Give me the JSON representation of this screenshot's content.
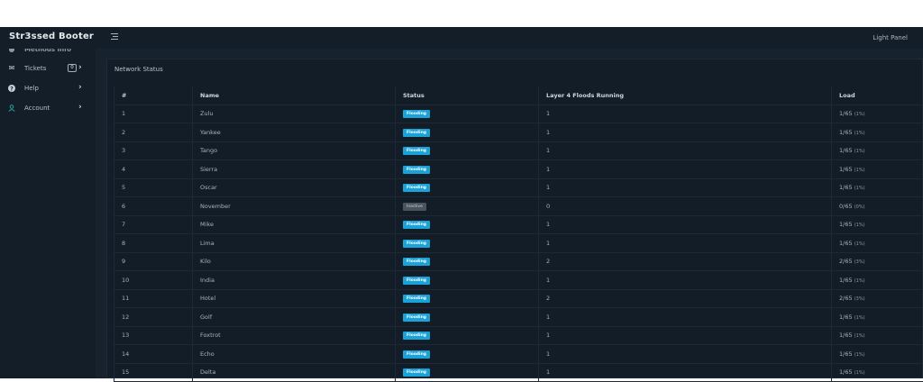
{
  "app": {
    "brand": "Str3ssed Booter",
    "right_label": "Light Panel"
  },
  "sidebar": {
    "cut_item": "Methods Info",
    "items": [
      {
        "label": "Tickets",
        "badge": "0"
      },
      {
        "label": "Help"
      },
      {
        "label": "Account"
      }
    ]
  },
  "panel": {
    "title": "Network Status",
    "columns": [
      "#",
      "Name",
      "Status",
      "Layer 4 Floods Running",
      "Load"
    ],
    "rows": [
      {
        "num": "1",
        "name": "Zulu",
        "status": "Flooding",
        "floods": "1",
        "load": "1/65",
        "pct": "(1%)"
      },
      {
        "num": "2",
        "name": "Yankee",
        "status": "Flooding",
        "floods": "1",
        "load": "1/65",
        "pct": "(1%)"
      },
      {
        "num": "3",
        "name": "Tango",
        "status": "Flooding",
        "floods": "1",
        "load": "1/65",
        "pct": "(1%)"
      },
      {
        "num": "4",
        "name": "Sierra",
        "status": "Flooding",
        "floods": "1",
        "load": "1/65",
        "pct": "(1%)"
      },
      {
        "num": "5",
        "name": "Oscar",
        "status": "Flooding",
        "floods": "1",
        "load": "1/65",
        "pct": "(1%)"
      },
      {
        "num": "6",
        "name": "November",
        "status": "Inactive",
        "floods": "0",
        "load": "0/65",
        "pct": "(0%)"
      },
      {
        "num": "7",
        "name": "Mike",
        "status": "Flooding",
        "floods": "1",
        "load": "1/65",
        "pct": "(1%)"
      },
      {
        "num": "8",
        "name": "Lima",
        "status": "Flooding",
        "floods": "1",
        "load": "1/65",
        "pct": "(1%)"
      },
      {
        "num": "9",
        "name": "Kilo",
        "status": "Flooding",
        "floods": "2",
        "load": "2/65",
        "pct": "(3%)"
      },
      {
        "num": "10",
        "name": "India",
        "status": "Flooding",
        "floods": "1",
        "load": "1/65",
        "pct": "(1%)"
      },
      {
        "num": "11",
        "name": "Hotel",
        "status": "Flooding",
        "floods": "2",
        "load": "2/65",
        "pct": "(3%)"
      },
      {
        "num": "12",
        "name": "Golf",
        "status": "Flooding",
        "floods": "1",
        "load": "1/65",
        "pct": "(1%)"
      },
      {
        "num": "13",
        "name": "Foxtrot",
        "status": "Flooding",
        "floods": "1",
        "load": "1/65",
        "pct": "(1%)"
      },
      {
        "num": "14",
        "name": "Echo",
        "status": "Flooding",
        "floods": "1",
        "load": "1/65",
        "pct": "(1%)"
      },
      {
        "num": "15",
        "name": "Delta",
        "status": "Flooding",
        "floods": "1",
        "load": "1/65",
        "pct": "(1%)"
      }
    ]
  },
  "colors": {
    "flooding": "#1aa3d8",
    "inactive": "#4a545d",
    "background": "#16222d",
    "sidebar": "#131e28"
  },
  "icons": {
    "menu": "hamburger-icon",
    "tickets": "envelope-icon",
    "help": "question-circle-icon",
    "account": "user-icon",
    "expand": "chevron-right-icon"
  }
}
